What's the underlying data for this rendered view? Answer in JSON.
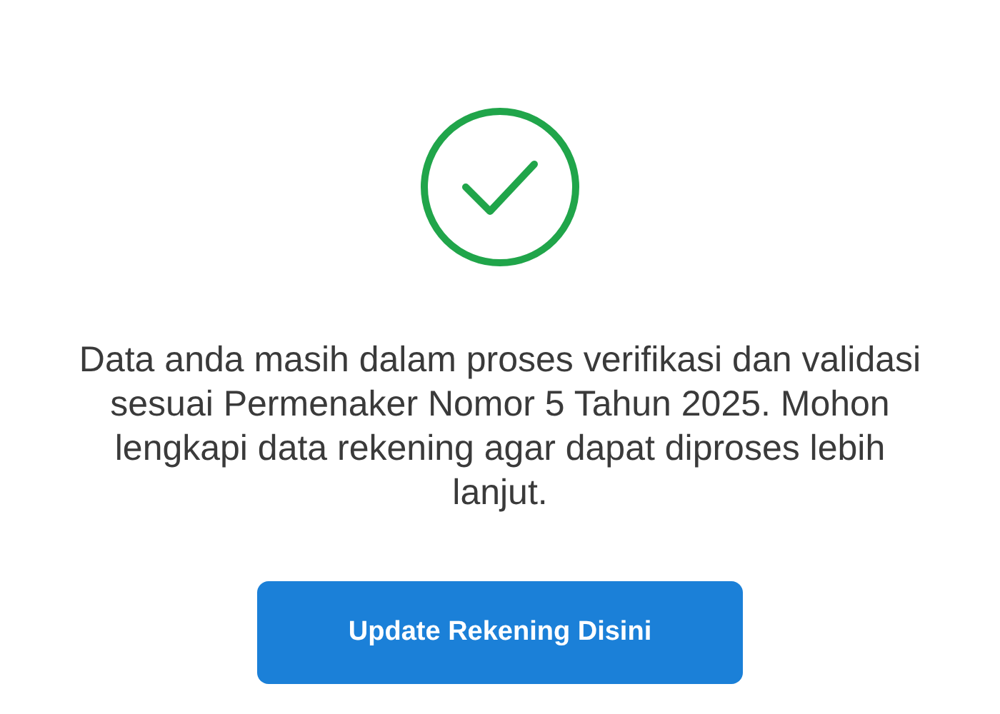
{
  "status": {
    "kind": "success"
  },
  "message": "Data anda masih dalam proses verifikasi dan validasi sesuai Permenaker Nomor 5 Tahun 2025. Mohon lengkapi data rekening agar dapat diproses lebih lanjut.",
  "button": {
    "label": "Update Rekening Disini"
  }
}
